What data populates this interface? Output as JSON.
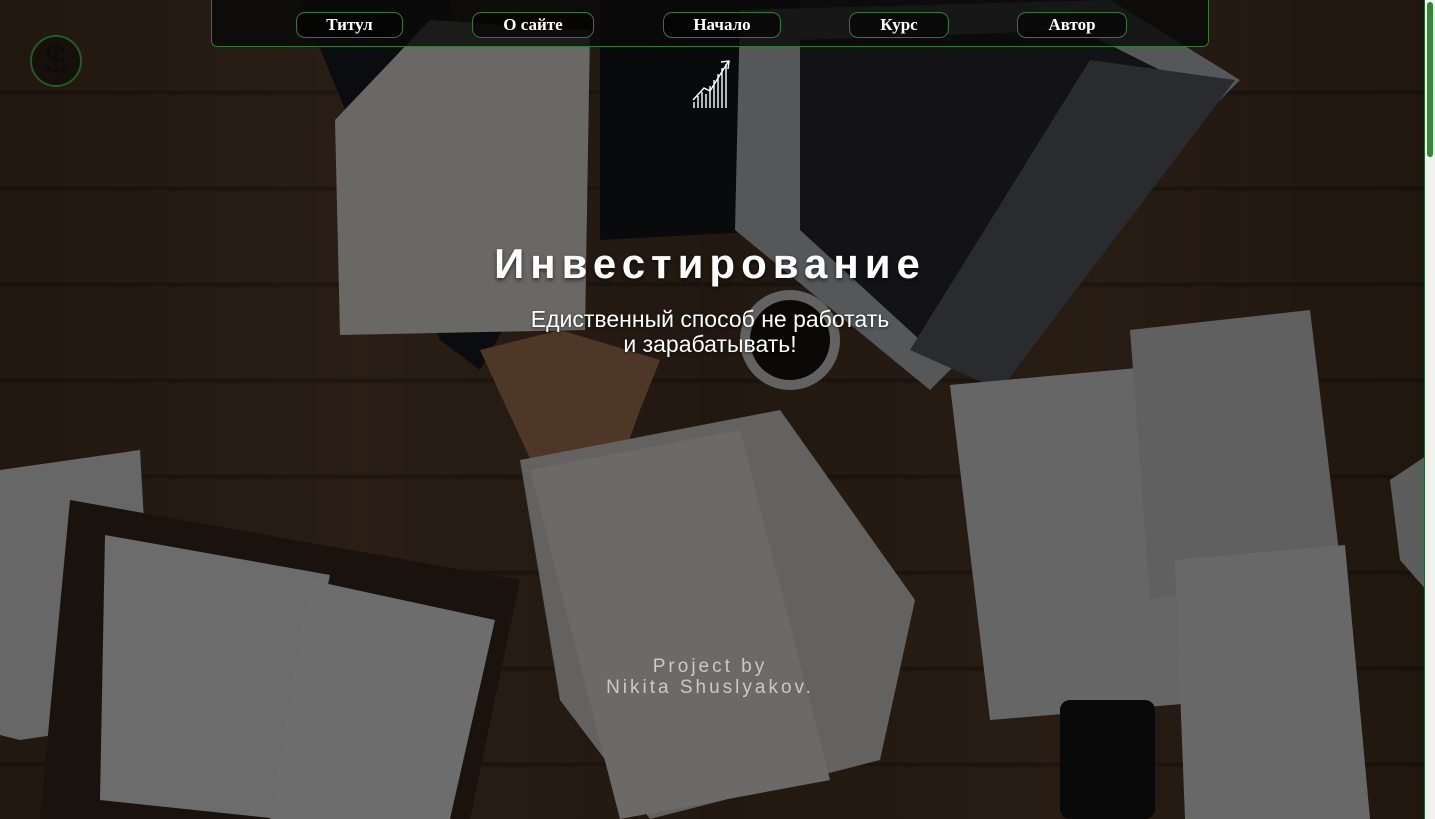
{
  "nav": {
    "items": [
      {
        "label": "Титул"
      },
      {
        "label": "О сайте"
      },
      {
        "label": "Начало"
      },
      {
        "label": "Курс"
      },
      {
        "label": "Автор"
      }
    ]
  },
  "logo": {
    "icon": "dollar-icon",
    "symbol": "$"
  },
  "hero": {
    "title": "Инвестирование",
    "subtitle_line1": "Едиственный способ не работать",
    "subtitle_line2": "и зарабатывать!",
    "chart_icon": "growth-chart-icon"
  },
  "credit": {
    "line1": "Project by",
    "line2": "Nikita Shuslyakov."
  },
  "colors": {
    "accent_green": "#2f7a34",
    "scroll_thumb": "#2e8b34",
    "text": "#ffffff"
  }
}
